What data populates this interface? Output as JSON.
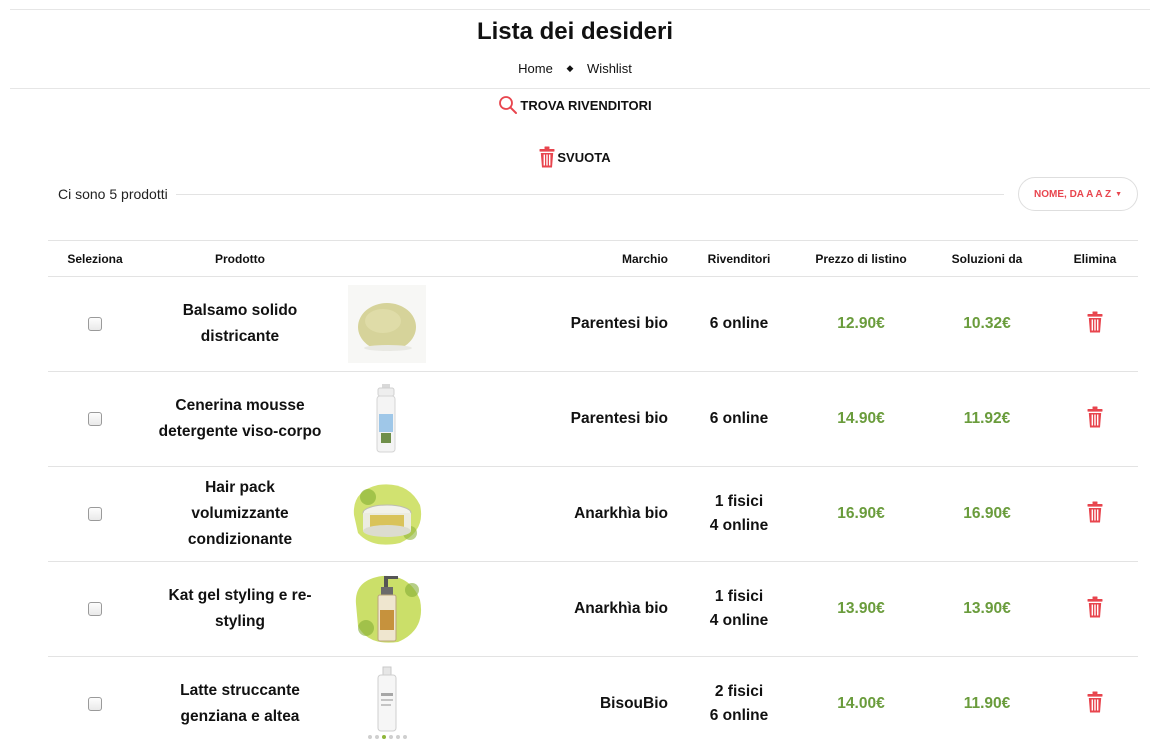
{
  "page": {
    "title": "Lista dei desideri"
  },
  "breadcrumb": {
    "home": "Home",
    "current": "Wishlist"
  },
  "actions": {
    "find_retailers": "TROVA RIVENDITORI",
    "empty": "SVUOTA"
  },
  "list": {
    "count_label": "Ci sono 5 prodotti",
    "sort_label": "NOME, DA A A Z"
  },
  "table": {
    "headers": {
      "select": "Seleziona",
      "product": "Prodotto",
      "brand": "Marchio",
      "retailers": "Rivenditori",
      "list_price": "Prezzo di listino",
      "solutions_from": "Soluzioni da",
      "delete": "Elimina"
    },
    "rows": [
      {
        "name": "Balsamo solido districante",
        "brand": "Parentesi bio",
        "retail_physical": "",
        "retail_online": "6 online",
        "list_price": "12.90€",
        "from_price": "10.32€",
        "image": "round-solid-conditioner"
      },
      {
        "name": "Cenerina mousse detergente viso-corpo",
        "brand": "Parentesi bio",
        "retail_physical": "",
        "retail_online": "6 online",
        "list_price": "14.90€",
        "from_price": "11.92€",
        "image": "foam-pump-bottle"
      },
      {
        "name": "Hair pack volumizzante condizionante",
        "brand": "Anarkhìa bio",
        "retail_physical": "1 fisici",
        "retail_online": "4 online",
        "list_price": "16.90€",
        "from_price": "16.90€",
        "image": "hair-pack-jar"
      },
      {
        "name": "Kat gel styling e re-styling",
        "brand": "Anarkhìa bio",
        "retail_physical": "1 fisici",
        "retail_online": "4 online",
        "list_price": "13.90€",
        "from_price": "13.90€",
        "image": "gel-pump-bottle"
      },
      {
        "name": "Latte struccante genziana e altea",
        "brand": "BisouBio",
        "retail_physical": "2 fisici",
        "retail_online": "6 online",
        "list_price": "14.00€",
        "from_price": "11.90€",
        "image": "cleansing-milk-bottle"
      }
    ]
  },
  "colors": {
    "accent": "#e8454e",
    "price": "#6a9c3c"
  },
  "icons": {
    "find": "search-icon",
    "empty": "trash-icon",
    "delete": "trash-icon",
    "sort": "caret-down-icon"
  }
}
